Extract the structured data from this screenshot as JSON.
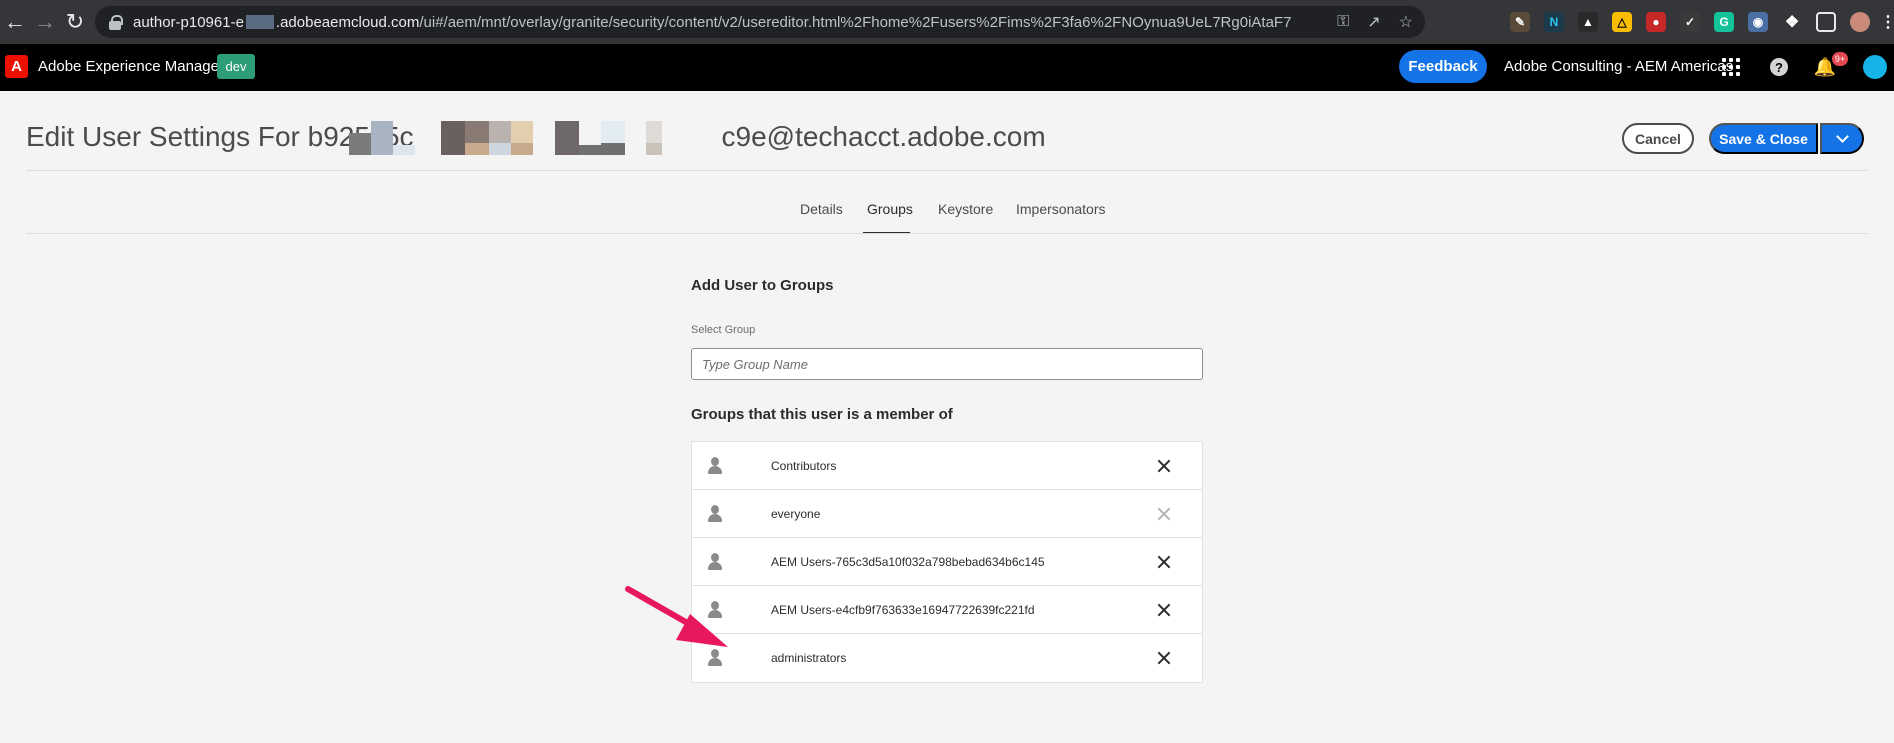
{
  "browser": {
    "url_prefix": "author-p10961-e",
    "url_host_rest": ".adobeaemcloud.com",
    "url_path": "/ui#/aem/mnt/overlay/granite/security/content/v2/usereditor.html%2Fhome%2Fusers%2Fims%2F3fa6%2FNOynua9UeL7Rg0iAtaF7"
  },
  "shell": {
    "app_title": "Adobe Experience Manager",
    "environment_badge": "dev",
    "feedback_label": "Feedback",
    "org_name": "Adobe Consulting - AEM Americas",
    "notification_count": "9+",
    "logo_letter": "A"
  },
  "page": {
    "title_prefix": "Edit User Settings For b925c5c",
    "title_suffix": "c9e@techacct.adobe.com",
    "cancel_label": "Cancel",
    "save_label": "Save & Close"
  },
  "tabs": [
    {
      "label": "Details",
      "active": false
    },
    {
      "label": "Groups",
      "active": true
    },
    {
      "label": "Keystore",
      "active": false
    },
    {
      "label": "Impersonators",
      "active": false
    }
  ],
  "groups_form": {
    "add_heading": "Add User to Groups",
    "select_label": "Select Group",
    "select_placeholder": "Type Group Name",
    "member_heading": "Groups that this user is a member of",
    "groups": [
      {
        "name": "Contributors",
        "removable": true
      },
      {
        "name": "everyone",
        "removable": false
      },
      {
        "name": "AEM Users-765c3d5a10f032a798bebad634b6c145",
        "removable": true
      },
      {
        "name": "AEM Users-e4cfb9f763633e16947722639fc221fd",
        "removable": true
      },
      {
        "name": "administrators",
        "removable": true
      }
    ]
  },
  "colors": {
    "accent_blue": "#1473e6",
    "env_green": "#2d9d78",
    "adobe_red": "#eb1000",
    "annotation_arrow": "#e8185f"
  }
}
